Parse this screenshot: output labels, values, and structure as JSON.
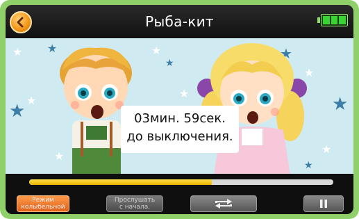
{
  "header": {
    "title": "Рыба-кит",
    "back_icon": "back-arrow-icon",
    "battery_level": 1.0
  },
  "overlay": {
    "line1": "03мин. 59сек.",
    "line2": "до выключения."
  },
  "playback": {
    "progress": 0.6
  },
  "controls": {
    "lullaby_line1": "Режим",
    "lullaby_line2": "колыбельной",
    "restart_line1": "Прослушать",
    "restart_line2": "с начала.",
    "repeat_icon": "repeat-icon",
    "pause_icon": "pause-icon"
  },
  "colors": {
    "frame": "#8fd06a",
    "accent": "#f49a1a",
    "progress": "#f3c614"
  }
}
